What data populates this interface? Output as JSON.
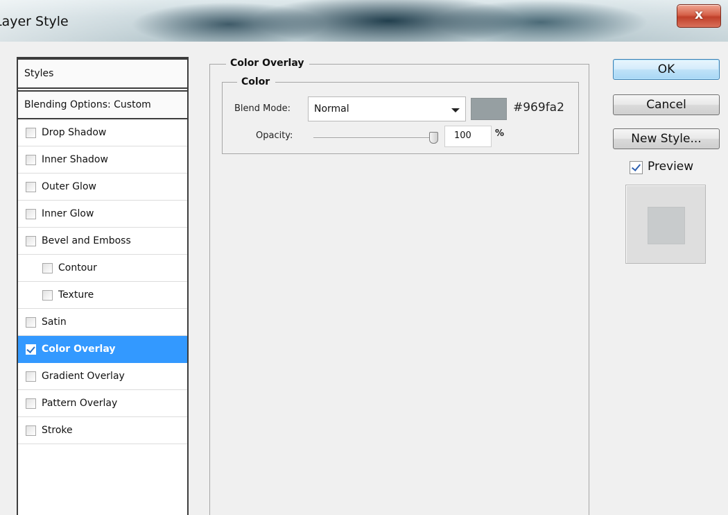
{
  "window": {
    "title": "Layer Style",
    "close_label": "x"
  },
  "styles_panel": {
    "header": "Styles",
    "blending_options": "Blending Options: Custom",
    "items": [
      {
        "label": "Drop Shadow",
        "checked": false,
        "indent": false
      },
      {
        "label": "Inner Shadow",
        "checked": false,
        "indent": false
      },
      {
        "label": "Outer Glow",
        "checked": false,
        "indent": false
      },
      {
        "label": "Inner Glow",
        "checked": false,
        "indent": false
      },
      {
        "label": "Bevel and Emboss",
        "checked": false,
        "indent": false
      },
      {
        "label": "Contour",
        "checked": false,
        "indent": true
      },
      {
        "label": "Texture",
        "checked": false,
        "indent": true
      },
      {
        "label": "Satin",
        "checked": false,
        "indent": false
      },
      {
        "label": "Color Overlay",
        "checked": true,
        "indent": false,
        "selected": true
      },
      {
        "label": "Gradient Overlay",
        "checked": false,
        "indent": false
      },
      {
        "label": "Pattern Overlay",
        "checked": false,
        "indent": false
      },
      {
        "label": "Stroke",
        "checked": false,
        "indent": false
      }
    ]
  },
  "color_overlay": {
    "section_title": "Color Overlay",
    "group_title": "Color",
    "blend_mode_label": "Blend Mode:",
    "blend_mode_value": "Normal",
    "color_hex": "#969fa2",
    "color_hex_text": "#969fa2",
    "opacity_label": "Opacity:",
    "opacity_value": "100",
    "opacity_unit": "%"
  },
  "buttons": {
    "ok": "OK",
    "cancel": "Cancel",
    "new_style": "New Style...",
    "preview_label": "Preview",
    "preview_checked": true
  },
  "colors": {
    "selection": "#3399ff",
    "preview_swatch": "#c8cbcc"
  }
}
